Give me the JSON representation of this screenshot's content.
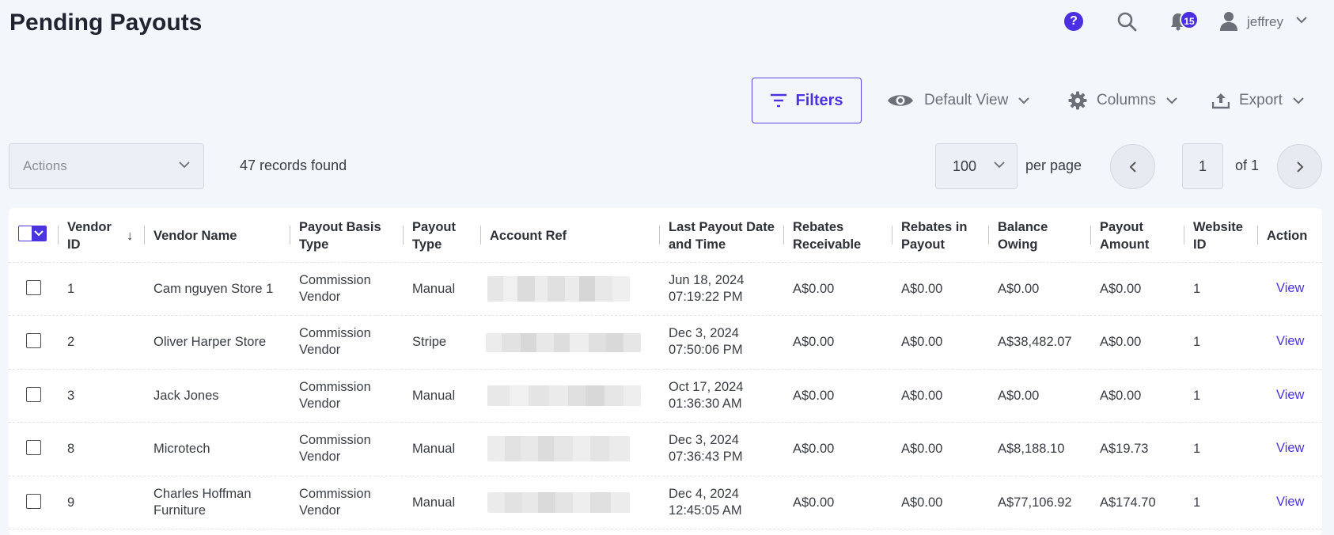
{
  "page": {
    "title": "Pending Payouts"
  },
  "header": {
    "help_glyph": "?",
    "notification_count": "15",
    "user_name": "jeffrey"
  },
  "toolbar": {
    "filters_label": "Filters",
    "view_label": "Default View",
    "columns_label": "Columns",
    "export_label": "Export"
  },
  "list_controls": {
    "actions_placeholder": "Actions",
    "records_found": "47 records found",
    "per_page_value": "100",
    "per_page_label": "per page",
    "current_page": "1",
    "page_total": "of 1"
  },
  "table": {
    "columns": [
      "Vendor ID",
      "Vendor Name",
      "Payout Basis Type",
      "Payout Type",
      "Account Ref",
      "Last Payout Date and Time",
      "Rebates Receivable",
      "Rebates in Payout",
      "Balance Owing",
      "Payout Amount",
      "Website ID",
      "Action"
    ],
    "sort_indicator": "↓",
    "rows": [
      {
        "vendor_id": "1",
        "vendor_name": "Cam nguyen Store 1",
        "basis_1": "Commission",
        "basis_2": "Vendor",
        "payout_type": "Manual",
        "date": "Jun 18, 2024",
        "time": "07:19:22 PM",
        "rebates_receivable": "A$0.00",
        "rebates_in_payout": "A$0.00",
        "balance_owing": "A$0.00",
        "payout_amount": "A$0.00",
        "website_id": "1",
        "action": "View"
      },
      {
        "vendor_id": "2",
        "vendor_name": "Oliver Harper Store",
        "basis_1": "Commission",
        "basis_2": "Vendor",
        "payout_type": "Stripe",
        "date": "Dec 3, 2024",
        "time": "07:50:06 PM",
        "rebates_receivable": "A$0.00",
        "rebates_in_payout": "A$0.00",
        "balance_owing": "A$38,482.07",
        "payout_amount": "A$0.00",
        "website_id": "1",
        "action": "View"
      },
      {
        "vendor_id": "3",
        "vendor_name": "Jack Jones",
        "basis_1": "Commission",
        "basis_2": "Vendor",
        "payout_type": "Manual",
        "date": "Oct 17, 2024",
        "time": "01:36:30 AM",
        "rebates_receivable": "A$0.00",
        "rebates_in_payout": "A$0.00",
        "balance_owing": "A$0.00",
        "payout_amount": "A$0.00",
        "website_id": "1",
        "action": "View"
      },
      {
        "vendor_id": "8",
        "vendor_name": "Microtech",
        "basis_1": "Commission",
        "basis_2": "Vendor",
        "payout_type": "Manual",
        "date": "Dec 3, 2024",
        "time": "07:36:43 PM",
        "rebates_receivable": "A$0.00",
        "rebates_in_payout": "A$0.00",
        "balance_owing": "A$8,188.10",
        "payout_amount": "A$19.73",
        "website_id": "1",
        "action": "View"
      },
      {
        "vendor_id": "9",
        "vendor_name_1": "Charles Hoffman",
        "vendor_name_2": "Furniture",
        "basis_1": "Commission",
        "basis_2": "Vendor",
        "payout_type": "Manual",
        "date": "Dec 4, 2024",
        "time": "12:45:05 AM",
        "rebates_receivable": "A$0.00",
        "rebates_in_payout": "A$0.00",
        "balance_owing": "A$77,106.92",
        "payout_amount": "A$174.70",
        "website_id": "1",
        "action": "View"
      }
    ]
  },
  "icons": {
    "help": "help-icon",
    "search": "search-icon",
    "notifications": "bell-icon",
    "user": "user-icon",
    "filters": "filter-lines-icon",
    "view": "eye-icon",
    "columns": "gear-icon",
    "export": "upload-icon"
  },
  "colors": {
    "accent": "#4b34e0",
    "background": "#f3f6fb",
    "card": "#ffffff"
  }
}
